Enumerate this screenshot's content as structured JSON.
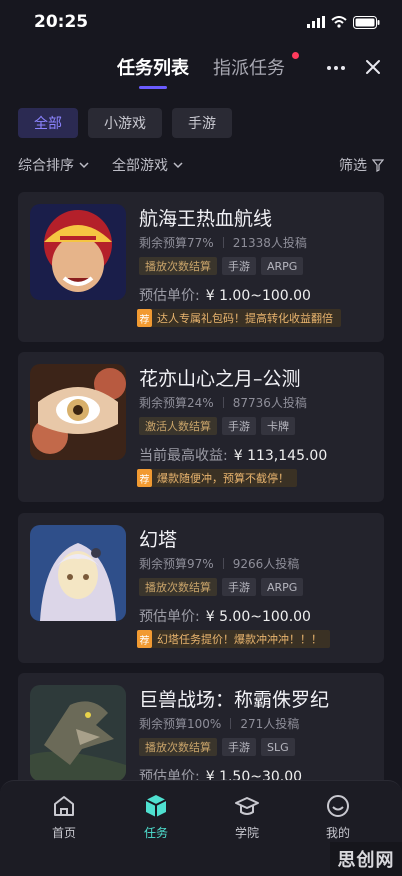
{
  "status_bar": {
    "time": "20:25"
  },
  "header": {
    "tabs": [
      {
        "label": "任务列表",
        "active": true
      },
      {
        "label": "指派任务",
        "active": false,
        "has_dot": true
      }
    ],
    "more_icon": "more-icon",
    "close_icon": "close-icon"
  },
  "chips": [
    {
      "label": "全部",
      "active": true
    },
    {
      "label": "小游戏",
      "active": false
    },
    {
      "label": "手游",
      "active": false
    }
  ],
  "filters": {
    "sort_label": "综合排序",
    "game_label": "全部游戏",
    "filter_label": "筛选"
  },
  "cards": [
    {
      "title": "航海王热血航线",
      "budget": "剩余预算77%",
      "submissions": "21338人投稿",
      "tags": [
        "播放次数结算",
        "手游",
        "ARPG"
      ],
      "price_label": "预估单价:",
      "price_value": "¥ 1.00~100.00",
      "promo_badge": "荐",
      "promo_text": "达人专属礼包码！提高转化收益翻倍",
      "image_colors": [
        "#1a1e4a",
        "#b4202a",
        "#f5c542"
      ]
    },
    {
      "title": "花亦山心之月–公测",
      "budget": "剩余预算24%",
      "submissions": "87736人投稿",
      "tags": [
        "激活人数结算",
        "手游",
        "卡牌"
      ],
      "price_label": "当前最高收益:",
      "price_value": "¥ 113,145.00",
      "promo_badge": "荐",
      "promo_text": "爆款随便冲，预算不截停！",
      "image_colors": [
        "#3c2418",
        "#c2694a",
        "#d8b06a"
      ]
    },
    {
      "title": "幻塔",
      "budget": "剩余预算97%",
      "submissions": "9266人投稿",
      "tags": [
        "播放次数结算",
        "手游",
        "ARPG"
      ],
      "price_label": "预估单价:",
      "price_value": "¥ 5.00~100.00",
      "promo_badge": "荐",
      "promo_text": "幻塔任务提价！爆款冲冲冲！！！",
      "image_colors": [
        "#2f4f8a",
        "#dcd6e8",
        "#f4e6c4"
      ]
    },
    {
      "title": "巨兽战场：称霸侏罗纪",
      "budget": "剩余预算100%",
      "submissions": "271人投稿",
      "tags": [
        "播放次数结算",
        "手游",
        "SLG"
      ],
      "price_label": "预估单价:",
      "price_value": "¥ 1.50~30.00",
      "image_colors": [
        "#2e3a3a",
        "#6b6a58",
        "#a8a08a"
      ]
    }
  ],
  "bottom_nav": [
    {
      "label": "首页",
      "icon": "home-icon",
      "active": false
    },
    {
      "label": "任务",
      "icon": "task-cube-icon",
      "active": true
    },
    {
      "label": "学院",
      "icon": "graduation-cap-icon",
      "active": false
    },
    {
      "label": "我的",
      "icon": "profile-smile-icon",
      "active": false
    }
  ],
  "watermark": "思创网",
  "colors": {
    "accent": "#6b5cff",
    "nav_active": "#4fe0d0",
    "promo": "#f19a32"
  }
}
